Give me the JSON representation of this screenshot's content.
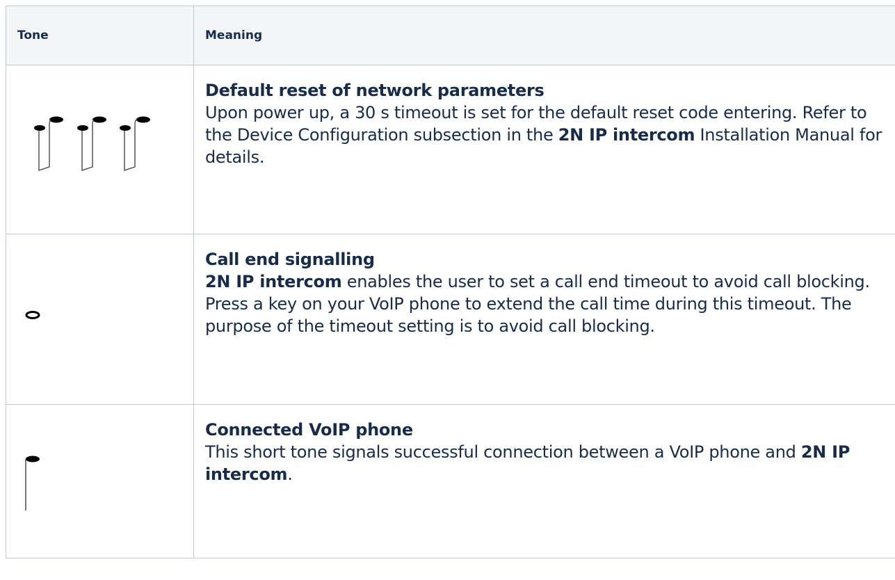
{
  "table": {
    "headers": [
      "Tone",
      "Meaning"
    ],
    "rows": [
      {
        "tone_icon": "four-note-tone-icon",
        "title": "Default reset of network parameters",
        "t1": "Upon power up, a 30 s timeout is set for the default reset code entering. Refer to the Device Configuration subsection in the ",
        "b1": "2N IP intercom",
        "t2": " Installation Manual for details."
      },
      {
        "tone_icon": "whole-note-tone-icon",
        "title": "Call end signalling",
        "b0": "2N IP intercom",
        "t1": " enables the user to set a call end timeout to avoid call blocking. Press a key on your VoIP phone to extend the call time during this timeout. The purpose of the timeout setting is to avoid call blocking."
      },
      {
        "tone_icon": "eighth-note-tone-icon",
        "title": "Connected VoIP phone",
        "t1": "This short tone signals successful connection between a VoIP phone and ",
        "b1": "2N IP intercom",
        "t2": "."
      }
    ]
  }
}
